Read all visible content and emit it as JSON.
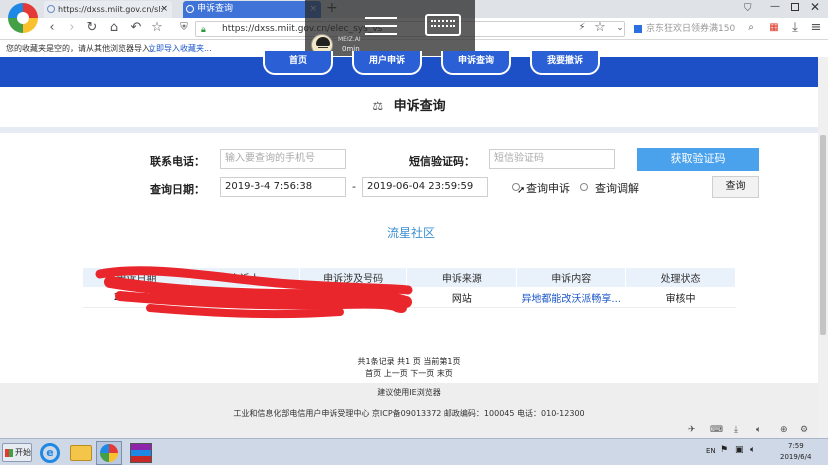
{
  "browser": {
    "tabs": [
      {
        "label": "https://dxss.miit.gov.cn/sl:"
      },
      {
        "label": "申诉查询"
      }
    ],
    "new_tab": "+",
    "url": "https://dxss.miit.gov.cn/elec_sys_vs",
    "search_placeholder": "京东狂欢日领券满150",
    "favorites_text": "您的收藏夹是空的，请从其他浏览器导入。",
    "favorites_link": "立即导入收藏夹..."
  },
  "overlay": {
    "avatar_label": "MEIZ.AI",
    "timer": "0min"
  },
  "site_nav": {
    "items": [
      "首页",
      "用户申诉",
      "申诉查询",
      "我要撤诉"
    ]
  },
  "page": {
    "title": "申诉查询"
  },
  "form": {
    "phone_label": "联系电话：",
    "phone_placeholder": "输入要查询的手机号",
    "sms_label": "短信验证码：",
    "sms_placeholder": "短信验证码",
    "get_code_button": "获取验证码",
    "date_label": "查询日期：",
    "date_from": "2019-3-4 7:56:38",
    "date_sep": "-",
    "date_to": "2019-06-04 23:59:59",
    "radio_complaint": "查询申诉",
    "radio_mediation": "查询调解",
    "query_button": "查询"
  },
  "watermark": "流星社区",
  "table": {
    "headers": [
      "申诉日期",
      "申诉人",
      "申诉涉及号码",
      "申诉来源",
      "申诉内容",
      "处理状态"
    ],
    "rows": [
      {
        "date": "2019-03-",
        "name": "张**",
        "number": "",
        "source": "网站",
        "content": "异地都能改沃派畅享...",
        "status": "审核中"
      }
    ]
  },
  "pagination": {
    "summary": "共1条记录 共1 页 当前第1页",
    "first": "首页",
    "prev": "上一页",
    "next": "下一页",
    "last": "末页"
  },
  "footer": {
    "browser_hint": "建议使用IE浏览器",
    "org": "工业和信息化部电信用户申诉受理中心 京ICP备09013372 邮政编码：100045 电话：010-12300"
  },
  "taskbar": {
    "start": "开始",
    "time": "7:59",
    "date": "2019/6/4",
    "lang": "EN"
  },
  "colors": {
    "nav_blue": "#1d4fc7",
    "button_blue": "#4aa2ec",
    "link_blue": "#1a55c8",
    "watermark": "#3a8fd0",
    "scribble_red": "#e8262c"
  }
}
